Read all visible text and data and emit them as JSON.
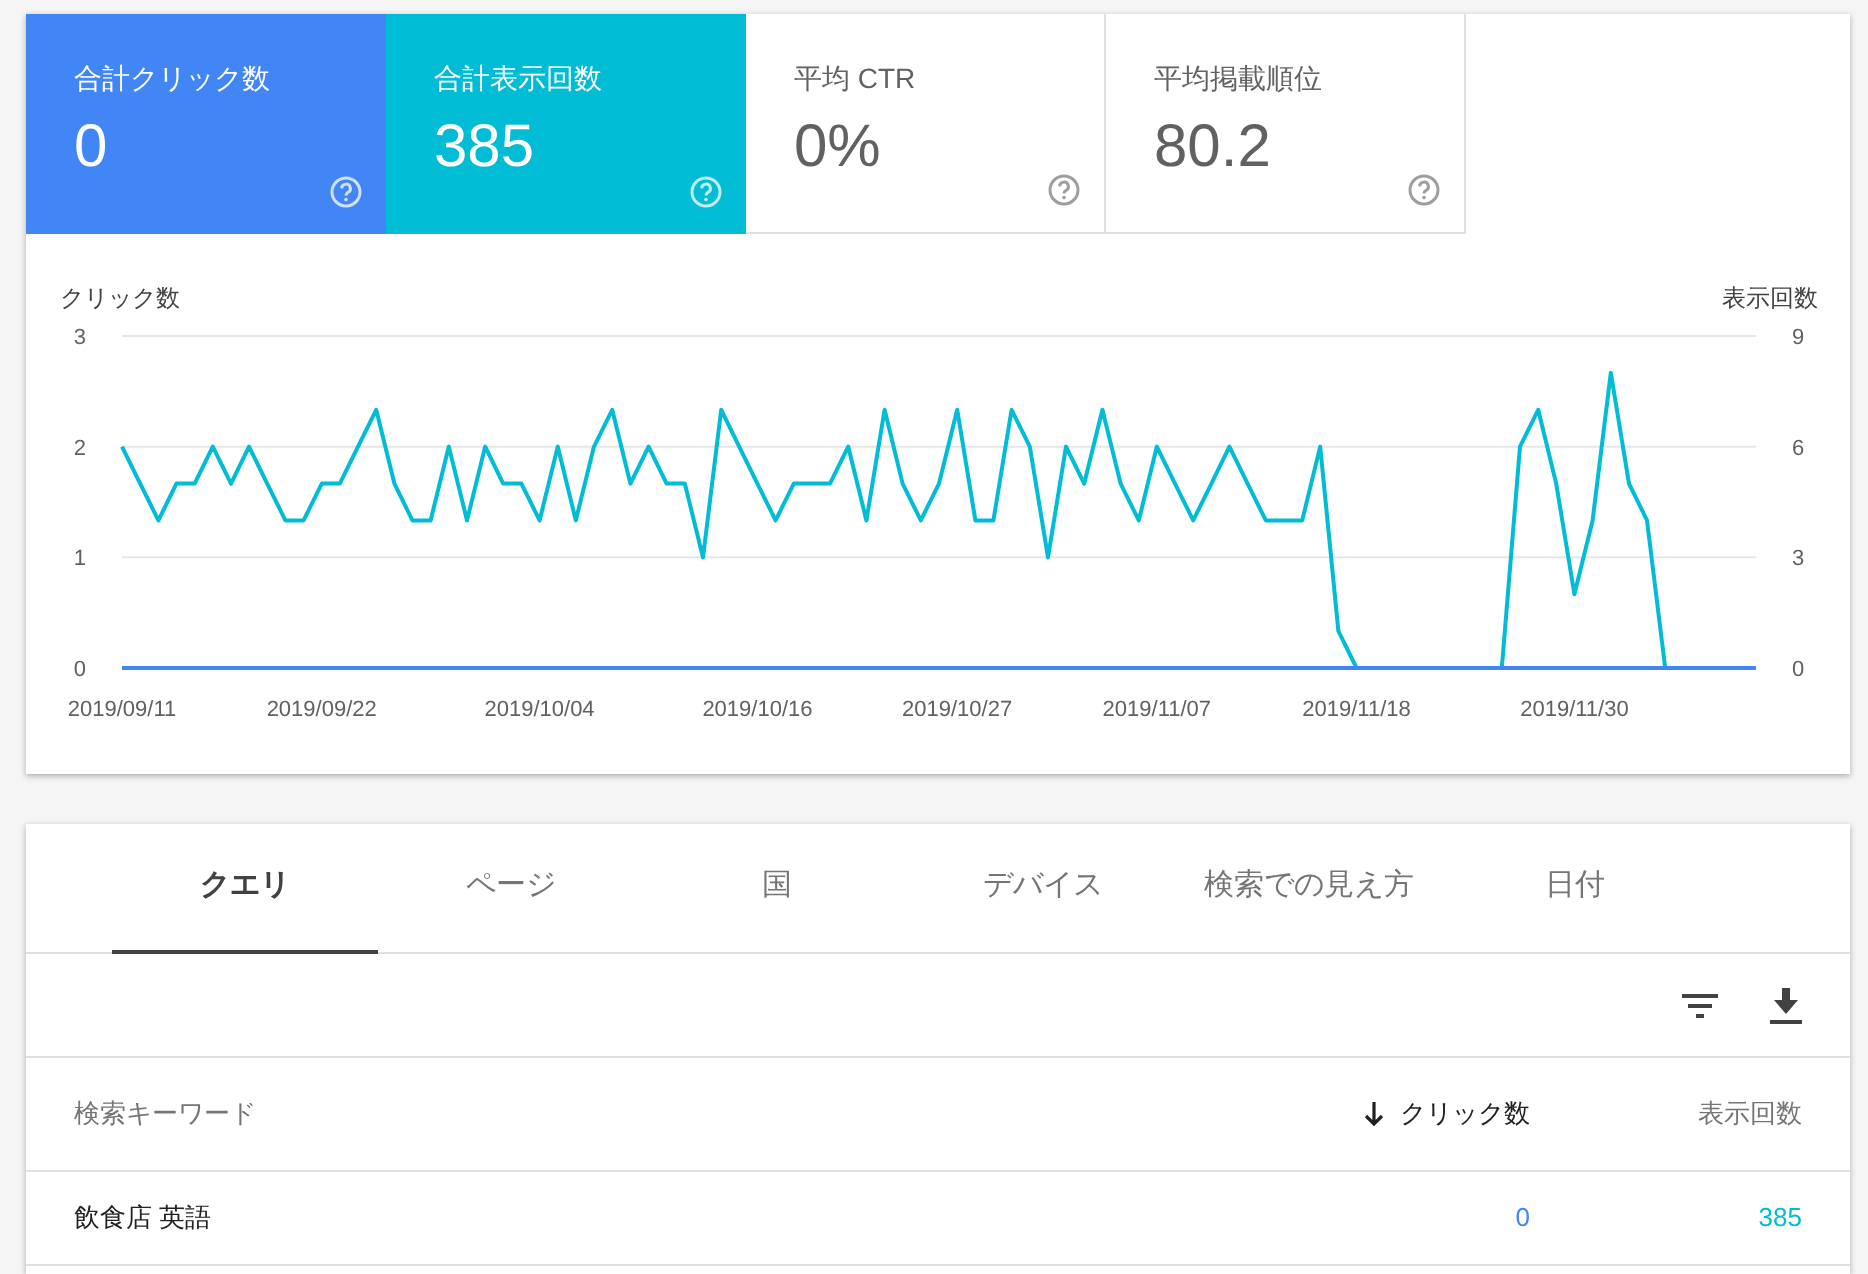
{
  "metrics": [
    {
      "label": "合計クリック数",
      "value": "0",
      "selected": true,
      "color": "#4285f4"
    },
    {
      "label": "合計表示回数",
      "value": "385",
      "selected": true,
      "color": "#00bcd4"
    },
    {
      "label": "平均 CTR",
      "value": "0%",
      "selected": false
    },
    {
      "label": "平均掲載順位",
      "value": "80.2",
      "selected": false
    }
  ],
  "chart": {
    "chart_data": {
      "type": "line",
      "ylabel": "クリック数",
      "y2label": "表示回数",
      "ylim": [
        0,
        3
      ],
      "yticks": [
        0,
        1,
        2,
        3
      ],
      "y2lim": [
        0,
        9
      ],
      "y2ticks": [
        0,
        3,
        6,
        9
      ],
      "categories": [
        "2019/09/11",
        null,
        null,
        null,
        null,
        null,
        null,
        null,
        null,
        null,
        null,
        "2019/09/22",
        null,
        null,
        null,
        null,
        null,
        null,
        null,
        null,
        null,
        null,
        null,
        "2019/10/04",
        null,
        null,
        null,
        null,
        null,
        null,
        null,
        null,
        null,
        null,
        null,
        "2019/10/16",
        null,
        null,
        null,
        null,
        null,
        null,
        null,
        null,
        null,
        null,
        "2019/10/27",
        null,
        null,
        null,
        null,
        null,
        null,
        null,
        null,
        null,
        null,
        "2019/11/07",
        null,
        null,
        null,
        null,
        null,
        null,
        null,
        null,
        null,
        null,
        "2019/11/18",
        null,
        null,
        null,
        null,
        null,
        null,
        null,
        null,
        null,
        null,
        null,
        "2019/11/30",
        null,
        null,
        null,
        null,
        null,
        null,
        null,
        null,
        null,
        null
      ],
      "series": [
        {
          "axis": "y2",
          "color": "#00bcd4",
          "values": [
            6,
            5,
            4,
            5,
            5,
            6,
            5,
            6,
            5,
            4,
            4,
            5,
            5,
            6,
            7,
            5,
            4,
            4,
            6,
            4,
            6,
            5,
            5,
            4,
            6,
            4,
            6,
            7,
            5,
            6,
            5,
            5,
            3,
            7,
            6,
            5,
            4,
            5,
            5,
            5,
            6,
            4,
            7,
            5,
            4,
            5,
            7,
            4,
            4,
            7,
            6,
            3,
            6,
            5,
            7,
            5,
            4,
            6,
            5,
            4,
            5,
            6,
            5,
            4,
            4,
            4,
            6,
            1,
            0,
            null,
            null,
            null,
            null,
            null,
            null,
            null,
            0,
            6,
            7,
            5,
            2,
            4,
            8,
            5,
            4,
            0,
            null,
            null,
            null,
            null,
            null
          ]
        },
        {
          "color": "#4285f4",
          "values": [
            0,
            0,
            0,
            0,
            0,
            0,
            0,
            0,
            0,
            0,
            0,
            0,
            0,
            0,
            0,
            0,
            0,
            0,
            0,
            0,
            0,
            0,
            0,
            0,
            0,
            0,
            0,
            0,
            0,
            0,
            0,
            0,
            0,
            0,
            0,
            0,
            0,
            0,
            0,
            0,
            0,
            0,
            0,
            0,
            0,
            0,
            0,
            0,
            0,
            0,
            0,
            0,
            0,
            0,
            0,
            0,
            0,
            0,
            0,
            0,
            0,
            0,
            0,
            0,
            0,
            0,
            0,
            0,
            0,
            0,
            0,
            0,
            0,
            0,
            0,
            0,
            0,
            0,
            0,
            0,
            0,
            0,
            0,
            0,
            0,
            0,
            0,
            0,
            0,
            0,
            0
          ]
        }
      ]
    }
  },
  "tabs": [
    {
      "label": "クエリ",
      "selected": true
    },
    {
      "label": "ページ",
      "selected": false
    },
    {
      "label": "国",
      "selected": false
    },
    {
      "label": "デバイス",
      "selected": false
    },
    {
      "label": "検索での見え方",
      "selected": false
    },
    {
      "label": "日付",
      "selected": false
    }
  ],
  "table": {
    "columns": [
      {
        "label": "検索キーワード",
        "sorted": false
      },
      {
        "label": "クリック数",
        "sorted": true
      },
      {
        "label": "表示回数",
        "sorted": false
      }
    ],
    "rows": [
      [
        "飲食店 英語",
        "0",
        "385"
      ]
    ]
  }
}
